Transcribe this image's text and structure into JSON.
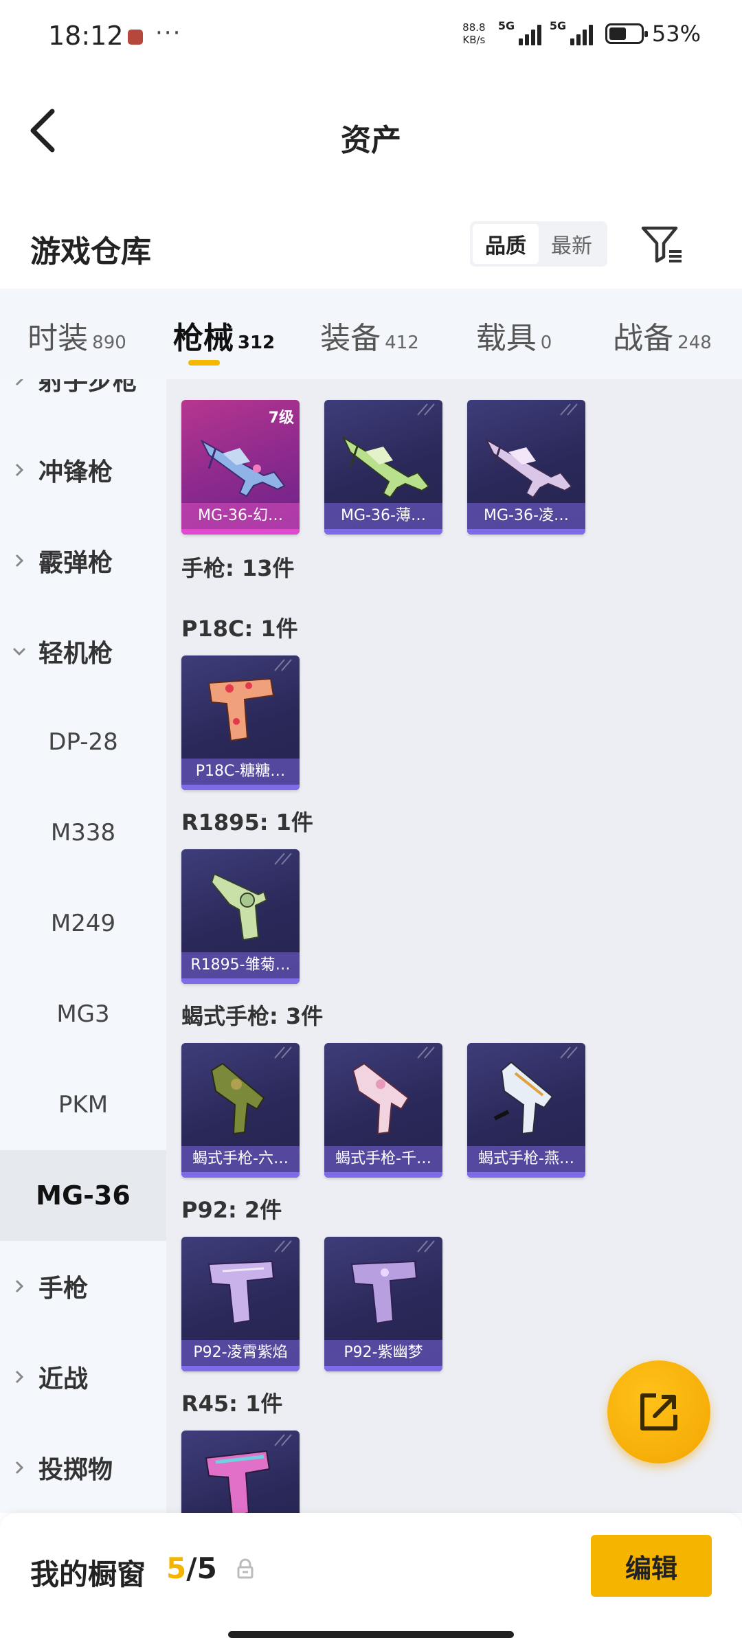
{
  "status_bar": {
    "time": "18:12",
    "dots": "···",
    "net_speed_value": "88.8",
    "net_speed_unit": "KB/s",
    "sim1_label": "5G",
    "sim2_label": "5G",
    "battery_pct": "53%"
  },
  "nav": {
    "title": "资产"
  },
  "section": {
    "title": "游戏仓库",
    "sort_options": [
      "品质",
      "最新"
    ],
    "active_sort": "品质"
  },
  "tabs": [
    {
      "label": "时装",
      "count": "890",
      "active": false
    },
    {
      "label": "枪械",
      "count": "312",
      "active": true
    },
    {
      "label": "装备",
      "count": "412",
      "active": false
    },
    {
      "label": "载具",
      "count": "0",
      "active": false
    },
    {
      "label": "战备",
      "count": "248",
      "active": false
    }
  ],
  "sidebar": {
    "items": [
      {
        "label": "射手步枪",
        "type": "category",
        "expanded": false
      },
      {
        "label": "冲锋枪",
        "type": "category",
        "expanded": false
      },
      {
        "label": "霰弹枪",
        "type": "category",
        "expanded": false
      },
      {
        "label": "轻机枪",
        "type": "category",
        "expanded": true
      },
      {
        "label": "DP-28",
        "type": "sub"
      },
      {
        "label": "M338",
        "type": "sub"
      },
      {
        "label": "M249",
        "type": "sub"
      },
      {
        "label": "MG3",
        "type": "sub"
      },
      {
        "label": "PKM",
        "type": "sub"
      },
      {
        "label": "MG-36",
        "type": "sub",
        "selected": true
      },
      {
        "label": "手枪",
        "type": "category",
        "expanded": false
      },
      {
        "label": "近战",
        "type": "category",
        "expanded": false
      },
      {
        "label": "投掷物",
        "type": "category",
        "expanded": false
      }
    ]
  },
  "content": {
    "mg36_cards": [
      {
        "name": "MG-36-幻…",
        "level": "7级",
        "rarity": "pink"
      },
      {
        "name": "MG-36-薄…",
        "rarity": "purple"
      },
      {
        "name": "MG-36-凌…",
        "rarity": "purple"
      }
    ],
    "pistol_header": "手枪: 13件",
    "groups": [
      {
        "title": "P18C: 1件",
        "cards": [
          {
            "name": "P18C-糖糖…"
          }
        ]
      },
      {
        "title": "R1895: 1件",
        "cards": [
          {
            "name": "R1895-雏菊…"
          }
        ]
      },
      {
        "title": "蝎式手枪: 3件",
        "cards": [
          {
            "name": "蝎式手枪-六…"
          },
          {
            "name": "蝎式手枪-千…"
          },
          {
            "name": "蝎式手枪-燕…"
          }
        ]
      },
      {
        "title": "P92: 2件",
        "cards": [
          {
            "name": "P92-凌霄紫焰"
          },
          {
            "name": "P92-紫幽梦"
          }
        ]
      },
      {
        "title": "R45: 1件",
        "cards": [
          {
            "name": ""
          }
        ]
      }
    ]
  },
  "bottom": {
    "showcase_label": "我的橱窗",
    "showcase_current": "5",
    "showcase_slash": "/",
    "showcase_total": "5",
    "edit_label": "编辑"
  },
  "colors": {
    "accent": "#f5b400",
    "card_purple": "#2a2858",
    "card_pink": "#b6368e"
  },
  "icons": [
    "back-arrow-icon",
    "filter-icon",
    "chevron-right-icon",
    "chevron-down-icon",
    "share-external-icon",
    "lock-icon"
  ]
}
